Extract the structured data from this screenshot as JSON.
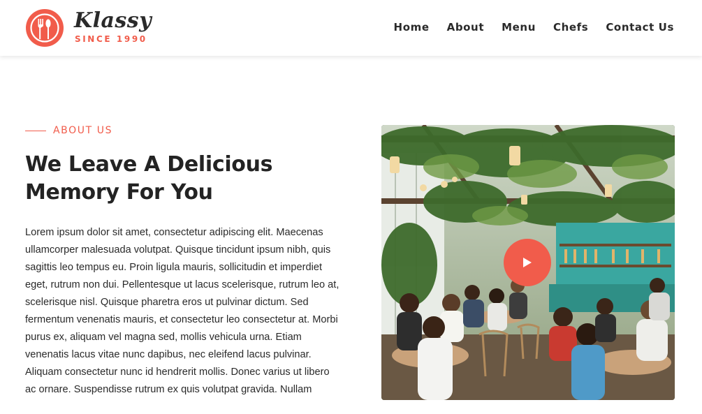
{
  "header": {
    "logo": {
      "word": "Klassy",
      "since": "SINCE 1990"
    },
    "nav": [
      {
        "label": "Home"
      },
      {
        "label": "About"
      },
      {
        "label": "Menu"
      },
      {
        "label": "Chefs"
      },
      {
        "label": "Contact Us"
      }
    ]
  },
  "about": {
    "eyebrow": "ABOUT US",
    "title_line1": "We Leave A Delicious",
    "title_line2": "Memory For You",
    "body": "Lorem ipsum dolor sit amet, consectetur adipiscing elit. Maecenas ullamcorper malesuada volutpat. Quisque tincidunt ipsum nibh, quis sagittis leo tempus eu. Proin ligula mauris, sollicitudin et imperdiet eget, rutrum non dui. Pellentesque ut lacus scelerisque, rutrum leo at, scelerisque nisl. Quisque pharetra eros ut pulvinar dictum. Sed fermentum venenatis mauris, et consectetur leo consectetur at. Morbi purus ex, aliquam vel magna sed, mollis vehicula urna. Etiam venenatis lacus vitae nunc dapibus, nec eleifend lacus pulvinar. Aliquam consectetur nunc id hendrerit mollis. Donec varius ut libero ac ornare. Suspendisse rutrum ex quis volutpat gravida. Nullam",
    "video": {
      "play_icon": "play-icon"
    }
  },
  "colors": {
    "accent": "#f15c4b",
    "text": "#2a2a2a"
  }
}
